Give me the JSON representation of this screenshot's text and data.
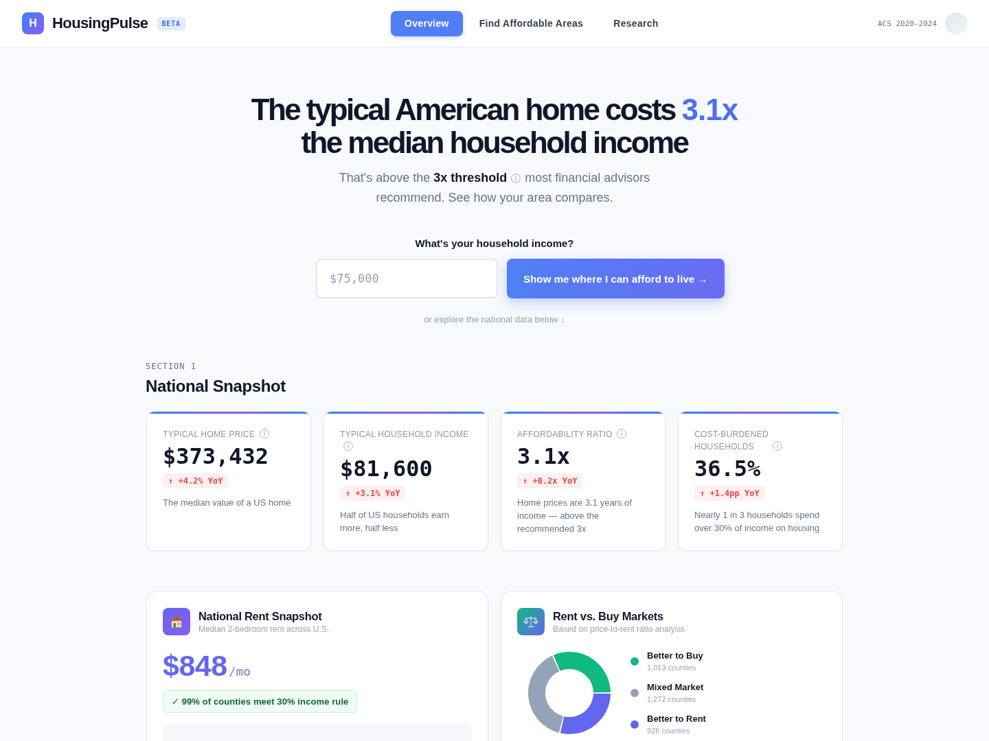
{
  "header": {
    "logo": {
      "mark": "H",
      "name": "HousingPulse",
      "badge": "BETA"
    },
    "nav": [
      {
        "label": "Overview",
        "selected": true
      },
      {
        "label": "Find Affordable Areas",
        "selected": false
      },
      {
        "label": "Research",
        "selected": false
      }
    ],
    "data_source": "ACS 2020-2024"
  },
  "hero": {
    "title": "The typical American home costs",
    "title_highlight": "3.1x",
    "title_end": "the median household income",
    "subtitle": {
      "before_info": "That's above the **3x threshold**",
      "after_info": "most financial advisors",
      "second_line": "recommend. See how your area compares."
    },
    "income_label": "What's your household income?",
    "income_input": {
      "placeholder": "$75,000"
    },
    "submit_button": "Show me where I can afford to live →",
    "explore_hint": "or explore the national data below ↓"
  },
  "section": {
    "eyebrow": "SECTION 1",
    "title": "National Snapshot",
    "stats": [
      {
        "label": "TYPICAL HOME PRICE",
        "value": "$373,432",
        "change": "↑ +4.2% YoY",
        "description": "The median value of a US home"
      },
      {
        "label": "TYPICAL HOUSEHOLD INCOME",
        "value": "$81,600",
        "change": "↑ +3.1% YoY",
        "description": "Half of US households earn more, half less"
      },
      {
        "label": "AFFORDABILITY RATIO",
        "value": "3.1x",
        "change": "↑ +0.2x YoY",
        "description": "Home prices are 3.1 years of income — above the recommended 3x"
      },
      {
        "label": "COST-BURDENED HOUSEHOLDS",
        "value": "36.5%",
        "change": "↑ +1.4pp YoY",
        "description": "Nearly 1 in 3 households spend over 30% of income on housing"
      }
    ]
  },
  "rent_card": {
    "title": "National Rent Snapshot",
    "subtitle": "Median 2-bedroom rent across U.S.",
    "price": "$848",
    "unit": "/mo",
    "rule_badge": "✓ 99% of counties meet 30% income rule"
  },
  "markets_card": {
    "title": "Rent vs. Buy Markets",
    "subtitle": "Based on price-to-rent ratio analysis",
    "chart_data": {
      "type": "donut",
      "categories": [
        "Better to Buy",
        "Mixed Market",
        "Better to Rent"
      ],
      "values": [
        31.6,
        39.6,
        28.8
      ]
    },
    "legend": [
      {
        "count": "1,013 counties",
        "color": "#10b981"
      },
      {
        "count": "1,272 counties",
        "color": "#94a3b8"
      },
      {
        "count": "926 counties",
        "color": "#6366f1"
      }
    ]
  }
}
